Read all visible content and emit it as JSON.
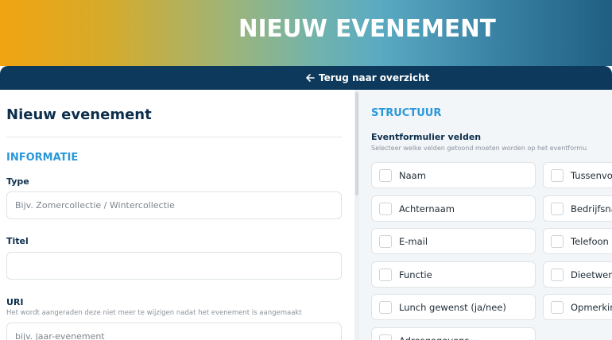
{
  "header": {
    "title": "NIEUW EVENEMENT",
    "back_label": "Terug naar overzicht"
  },
  "form": {
    "page_title": "Nieuw evenement",
    "section_title": "INFORMATIE",
    "type": {
      "label": "Type",
      "placeholder": "Bijv. Zomercollectie / Wintercollectie",
      "value": ""
    },
    "titel": {
      "label": "Titel",
      "placeholder": "",
      "value": ""
    },
    "uri": {
      "label": "URI",
      "help": "Het wordt aangeraden deze niet meer te wijzigen nadat het evenement is aangemaakt",
      "placeholder": "bijv. jaar-evenement",
      "value": ""
    }
  },
  "structuur": {
    "section_title": "STRUCTUUR",
    "subtitle": "Eventformulier velden",
    "help": "Selecteer welke velden getoond moeten worden op het eventformu",
    "fields_left": [
      "Naam",
      "Achternaam",
      "E-mail",
      "Functie",
      "Lunch gewenst (ja/nee)",
      "Adresgegevens"
    ],
    "fields_right": [
      "Tussenvoe",
      "Bedrijfsna",
      "Telefoon",
      "Dieetwens",
      "Opmerking"
    ]
  },
  "colors": {
    "brand_dark": "#0d3a5c",
    "accent_blue": "#2b98d9",
    "gradient_start": "#f1a411",
    "gradient_end": "#1f5f82"
  }
}
